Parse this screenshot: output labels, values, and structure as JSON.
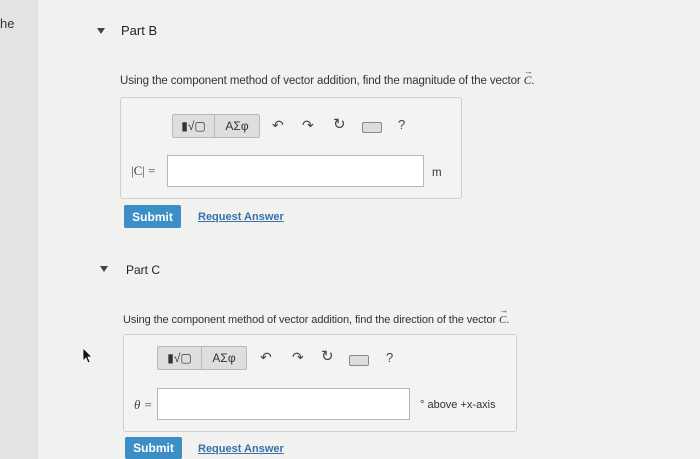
{
  "left_fragment": "he",
  "partB": {
    "title": "Part B",
    "prompt_prefix": "Using the component method of vector addition, find the magnitude of the vector ",
    "prompt_vector": "C",
    "prompt_suffix": ".",
    "toolbar": {
      "template_label": "▮√▢",
      "symbols_label": "ΑΣφ",
      "help_label": "?"
    },
    "input_label": "|C| =",
    "input_value": "",
    "unit": "m",
    "submit_label": "Submit",
    "request_label": "Request Answer"
  },
  "partC": {
    "title": "Part C",
    "prompt_prefix": "Using the component method of vector addition, find the direction of the vector ",
    "prompt_vector": "C",
    "prompt_suffix": ".",
    "toolbar": {
      "template_label": "▮√▢",
      "symbols_label": "ΑΣφ",
      "help_label": "?"
    },
    "input_label": "θ =",
    "input_value": "",
    "unit": "° above +x-axis",
    "submit_label": "Submit",
    "request_label": "Request Answer"
  },
  "colors": {
    "submit": "#3b8ec6",
    "link": "#3a6fa8"
  }
}
